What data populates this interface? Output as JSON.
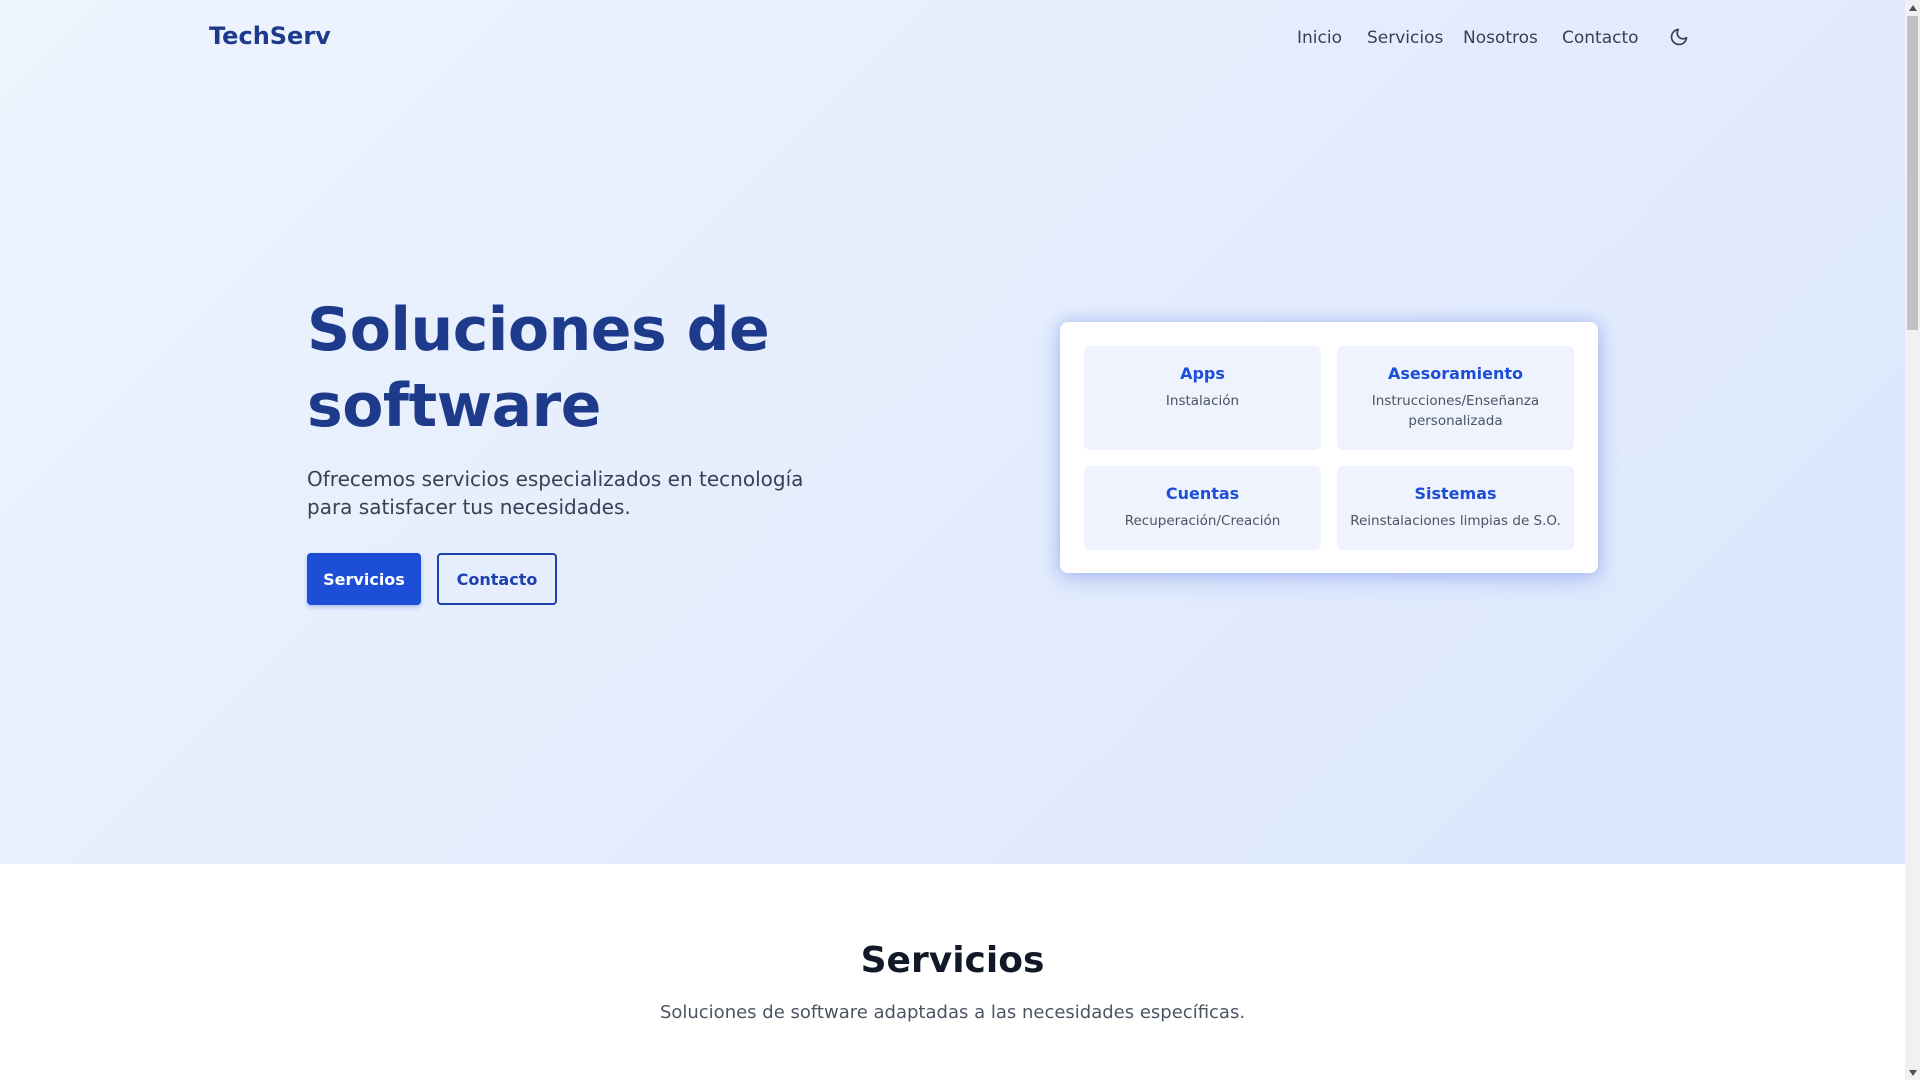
{
  "header": {
    "brand": "TechServ",
    "nav": [
      "Inicio",
      "Servicios",
      "Nosotros",
      "Contacto"
    ],
    "theme_toggle_icon": "moon-icon"
  },
  "hero": {
    "title_line1": "Soluciones de",
    "title_line2": "software",
    "subtitle": "Ofrecemos servicios especializados en tecnología para satisfacer tus necesidades.",
    "primary_button": "Servicios",
    "secondary_button": "Contacto"
  },
  "feature_card": {
    "tiles": [
      {
        "title": "Apps",
        "desc": "Instalación"
      },
      {
        "title": "Asesoramiento",
        "desc": "Instrucciones/Enseñanza personalizada"
      },
      {
        "title": "Cuentas",
        "desc": "Recuperación/Creación"
      },
      {
        "title": "Sistemas",
        "desc": "Reinstalaciones limpias de S.O."
      }
    ]
  },
  "services_section": {
    "title": "Servicios",
    "subtitle": "Soluciones de software adaptadas a las necesidades específicas."
  },
  "colors": {
    "brand": "#1e3a8a",
    "accent": "#1d4ed8",
    "hero_bg": "#e4edfd",
    "tile_bg": "#eef3fd"
  }
}
